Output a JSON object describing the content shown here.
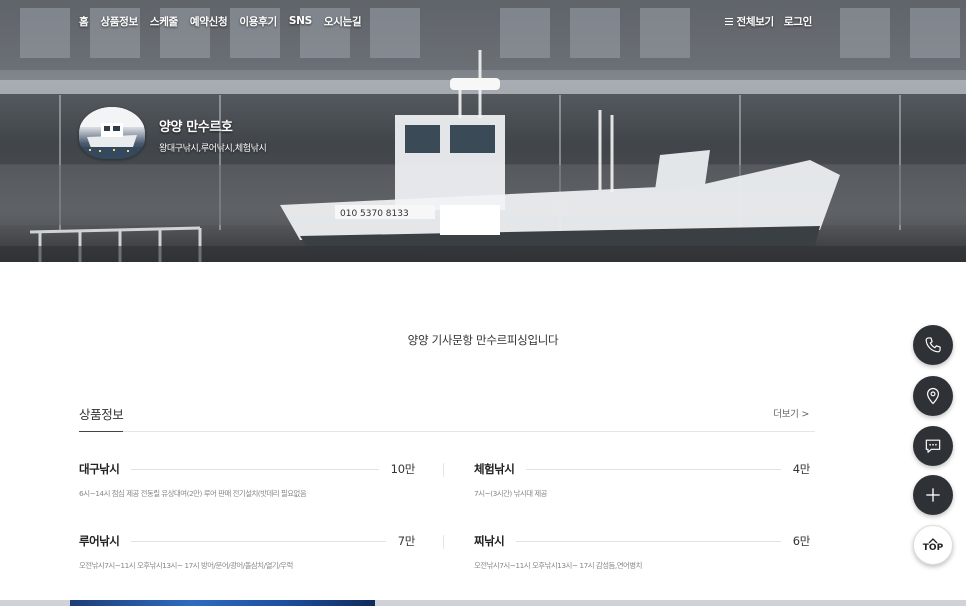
{
  "nav": {
    "items": [
      "홈",
      "상품정보",
      "스케줄",
      "예약신청",
      "이용후기",
      "SNS",
      "오시는길"
    ],
    "menu_all": "전체보기",
    "login": "로그인"
  },
  "profile": {
    "name": "양양 만수르호",
    "subtitle": "왕대구낚시,루어낚시,체험낚시"
  },
  "hero": {
    "boat_phone": "010 5370 8133"
  },
  "intro": "양양 기사문항 만수르피싱입니다",
  "products_section": {
    "title": "상품정보",
    "more": "더보기 >",
    "items": [
      {
        "name": "대구낚시",
        "price": "10만",
        "desc": "6시~14시 점심 제공 전동릴 유상대여(2만) 루어 판매 전기설치(밧데리 필요없음"
      },
      {
        "name": "체험낚시",
        "price": "4만",
        "desc": "7시~(3시간) 낚시대 제공"
      },
      {
        "name": "루어낚시",
        "price": "7만",
        "desc": "오전낚시7시~11시 오후낚시13시~ 17시 방어/문어/광어/돌삼치/열기/우럭"
      },
      {
        "name": "찌낚시",
        "price": "6만",
        "desc": "오전낚시7시~11시 오후낚시13시~ 17시 감성돔,연어병치"
      }
    ]
  },
  "floating": {
    "top_label": "TOP",
    "icons": [
      "phone-icon",
      "location-pin-icon",
      "chat-icon",
      "plus-icon"
    ]
  },
  "colors": {
    "float_bg": "#2e3135",
    "accent_line": "#444444"
  }
}
